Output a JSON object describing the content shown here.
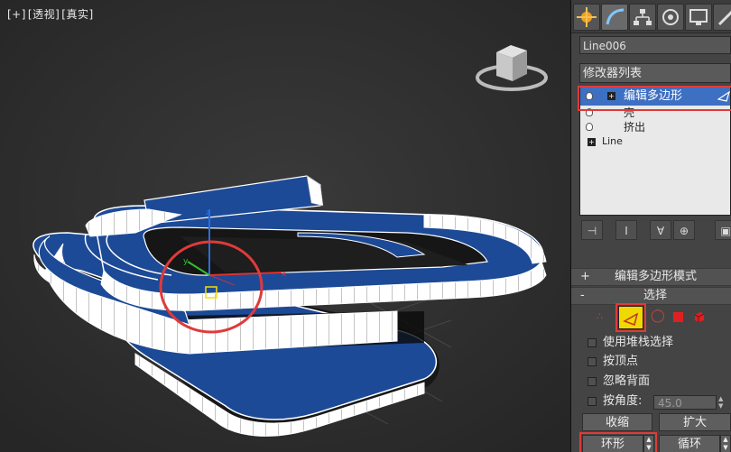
{
  "viewport": {
    "label_plus": "[+]",
    "label_view": "[透视]",
    "label_shading": "[真实]"
  },
  "command_panel": {
    "object_name": "Line006",
    "modifier_list_label": "修改器列表",
    "stack": [
      {
        "label": "编辑多边形",
        "selected": true,
        "has_plus": true,
        "has_bulb": true
      },
      {
        "label": "壳",
        "selected": false,
        "has_plus": false,
        "has_bulb": true
      },
      {
        "label": "挤出",
        "selected": false,
        "has_plus": false,
        "has_bulb": true
      },
      {
        "label": "Line",
        "selected": false,
        "has_plus": true,
        "has_bulb": false
      }
    ],
    "edit_poly_mode": {
      "sign": "+",
      "title": "编辑多边形模式"
    },
    "selection": {
      "sign": "-",
      "title": "选择",
      "use_stack_selection": "使用堆栈选择",
      "by_vertex": "按顶点",
      "ignore_backfacing": "忽略背面",
      "by_angle": "按角度:",
      "angle_value": "45.0",
      "shrink_button": "收缩",
      "grow_button": "扩大",
      "ring_button": "环形",
      "loop_button": "循环"
    }
  },
  "colors": {
    "mesh_blue": "#1d4a96",
    "selection_highlight": "#e03a3a",
    "stack_selected": "#3d6fc2"
  }
}
